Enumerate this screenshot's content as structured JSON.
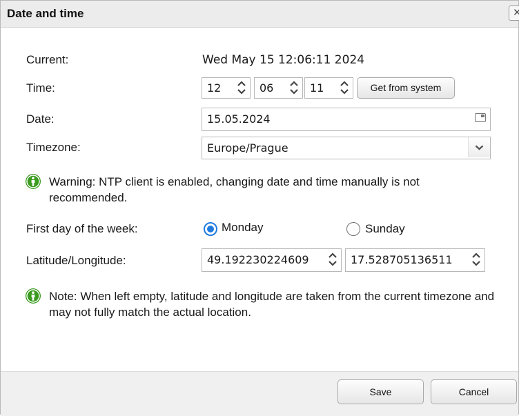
{
  "dialog": {
    "title": "Date and time",
    "close_glyph": "✕"
  },
  "form": {
    "current_label": "Current:",
    "current_value": "Wed May 15 12:06:11 2024",
    "time_label": "Time:",
    "hour": "12",
    "minute": "06",
    "second": "11",
    "get_from_system_label": "Get from system",
    "date_label": "Date:",
    "date_value": "15.05.2024",
    "timezone_label": "Timezone:",
    "timezone_value": "Europe/Prague",
    "warning_text": "Warning: NTP client is enabled, changing date and time manually is not recommended.",
    "first_day_label": "First day of the week:",
    "monday_label": "Monday",
    "sunday_label": "Sunday",
    "first_day_selected": "Monday",
    "latlon_label": "Latitude/Longitude:",
    "latitude": "49.192230224609",
    "longitude": "17.528705136511",
    "note_text": "Note: When left empty, latitude and longitude are taken from the current timezone and may not fully match the actual location."
  },
  "footer": {
    "save_label": "Save",
    "cancel_label": "Cancel"
  },
  "colors": {
    "accent": "#1f7be0",
    "info_icon": "#3a9b1f",
    "titlebar_bg": "#ececec",
    "footer_bg": "#f0f0f0"
  },
  "icons": {
    "close": "close-icon",
    "spinner": "spinner-arrows-icon",
    "calendar": "calendar-icon",
    "dropdown": "chevron-down-icon",
    "info": "info-person-icon"
  }
}
